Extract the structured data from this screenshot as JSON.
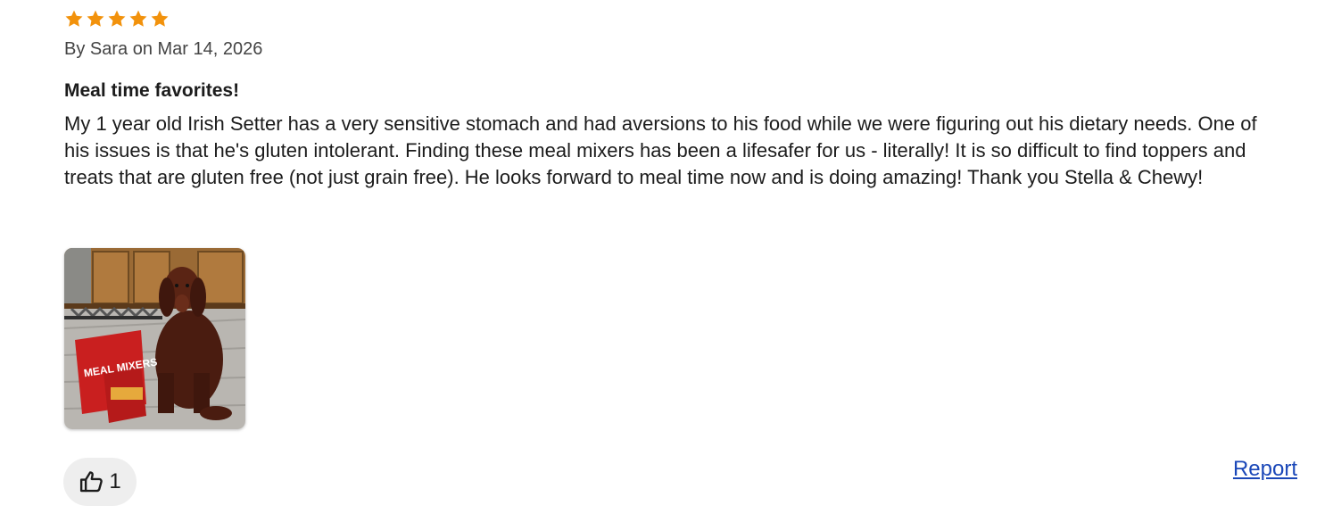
{
  "review": {
    "rating": 5,
    "max_rating": 5,
    "star_icon": "star-icon",
    "star_color": "#f2920c",
    "byline": "By Sara on Mar 14, 2026",
    "title": "Meal time favorites!",
    "body": "My 1 year old Irish Setter has a very sensitive stomach and had aversions to his food while we were figuring out his dietary needs. One of his issues is that he's gluten intolerant. Finding these meal mixers has been a lifesafer for us - literally! It is so difficult to find toppers and treats that are gluten free (not just grain free). He looks forward to meal time now and is doing amazing! Thank you Stella & Chewy!",
    "photo": {
      "package_text": "MEAL MIXERS"
    },
    "helpful": {
      "icon": "thumbs-up-icon",
      "count": "1"
    },
    "report_label": "Report",
    "link_color": "#1a47b8"
  }
}
